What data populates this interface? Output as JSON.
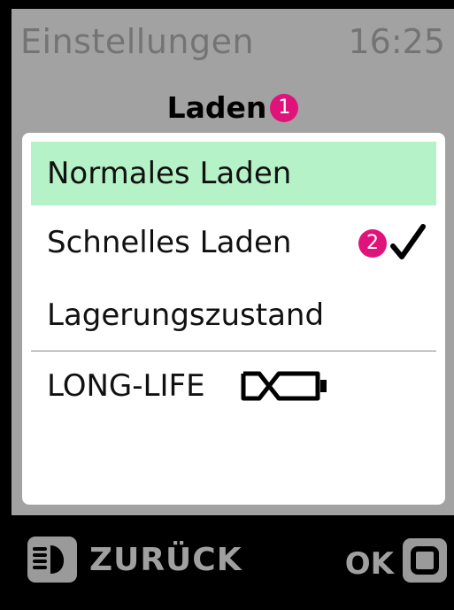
{
  "status_bar": {
    "app_title": "Einstellungen",
    "time": "16:25"
  },
  "screen": {
    "title": "Laden",
    "title_badge": "1"
  },
  "menu": {
    "items": [
      {
        "label": "Normales Laden",
        "selected": true
      },
      {
        "label": "Schnelles Laden",
        "badge": "2",
        "icon": "checkmark-icon",
        "checked": true
      },
      {
        "label": "Lagerungszustand"
      },
      {
        "label": "LONG-LIFE",
        "icon": "battery-longlife-icon"
      }
    ]
  },
  "bottom_bar": {
    "back_label": "ZURÜCK",
    "back_icon": "light-button-icon",
    "ok_label": "OK",
    "ok_icon": "ok-button-icon"
  },
  "colors": {
    "screen_background": "#a2a2a2",
    "selected_item": "#b6f2c7",
    "badge": "#e0137a",
    "bottom_bar": "#000000"
  }
}
